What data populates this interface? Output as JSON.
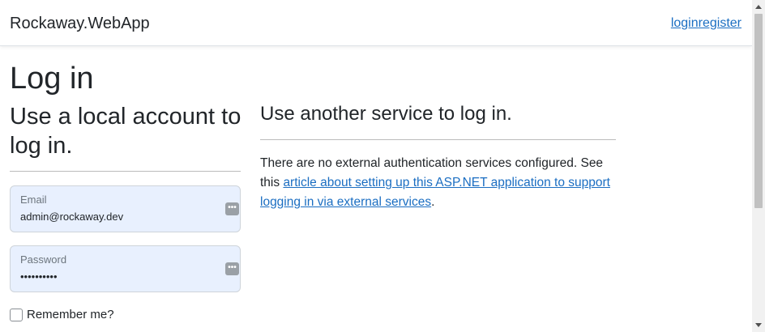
{
  "navbar": {
    "brand": "Rockaway.WebApp",
    "login_link": "login",
    "register_link": "register"
  },
  "page": {
    "title": "Log in"
  },
  "local_account": {
    "heading": "Use a local account to log in.",
    "email": {
      "label": "Email",
      "value": "admin@rockaway.dev"
    },
    "password": {
      "label": "Password",
      "value": "••••••••••"
    },
    "remember_label": "Remember me?",
    "remember_checked": false
  },
  "external": {
    "heading": "Use another service to log in.",
    "text_before": "There are no external authentication services configured. See this ",
    "link_text": "article about setting up this ASP.NET application to support logging in via external services",
    "text_after": "."
  },
  "colors": {
    "link": "#1b6ec2",
    "autofill_bg": "#e8f0fe"
  }
}
